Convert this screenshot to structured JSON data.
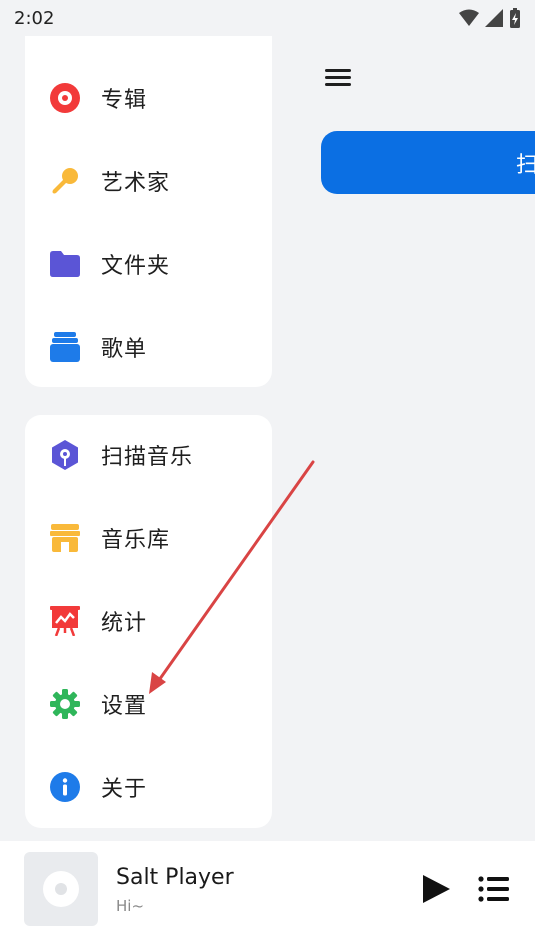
{
  "status_bar": {
    "time": "2:02"
  },
  "nav_top": [
    {
      "label": "专辑",
      "icon": "album-icon"
    },
    {
      "label": "艺术家",
      "icon": "microphone-icon"
    },
    {
      "label": "文件夹",
      "icon": "folder-icon"
    },
    {
      "label": "歌单",
      "icon": "playlist-icon"
    }
  ],
  "nav_bottom": [
    {
      "label": "扫描音乐",
      "icon": "scan-icon"
    },
    {
      "label": "音乐库",
      "icon": "store-icon"
    },
    {
      "label": "统计",
      "icon": "stats-icon"
    },
    {
      "label": "设置",
      "icon": "gear-icon"
    },
    {
      "label": "关于",
      "icon": "info-icon"
    }
  ],
  "main": {
    "scan_button_label": "扫"
  },
  "player": {
    "title": "Salt Player",
    "subtitle": "Hi~"
  },
  "colors": {
    "accent": "#0b6fe3",
    "album": "#f23a3a",
    "artist": "#f9b93a",
    "folder": "#5b55d6",
    "playlist": "#1e7be9",
    "scan": "#5b55d6",
    "store": "#f9b93a",
    "stats": "#f23a3a",
    "settings": "#2fb65a",
    "info": "#1e7be9",
    "annotation_arrow": "#d94444"
  }
}
